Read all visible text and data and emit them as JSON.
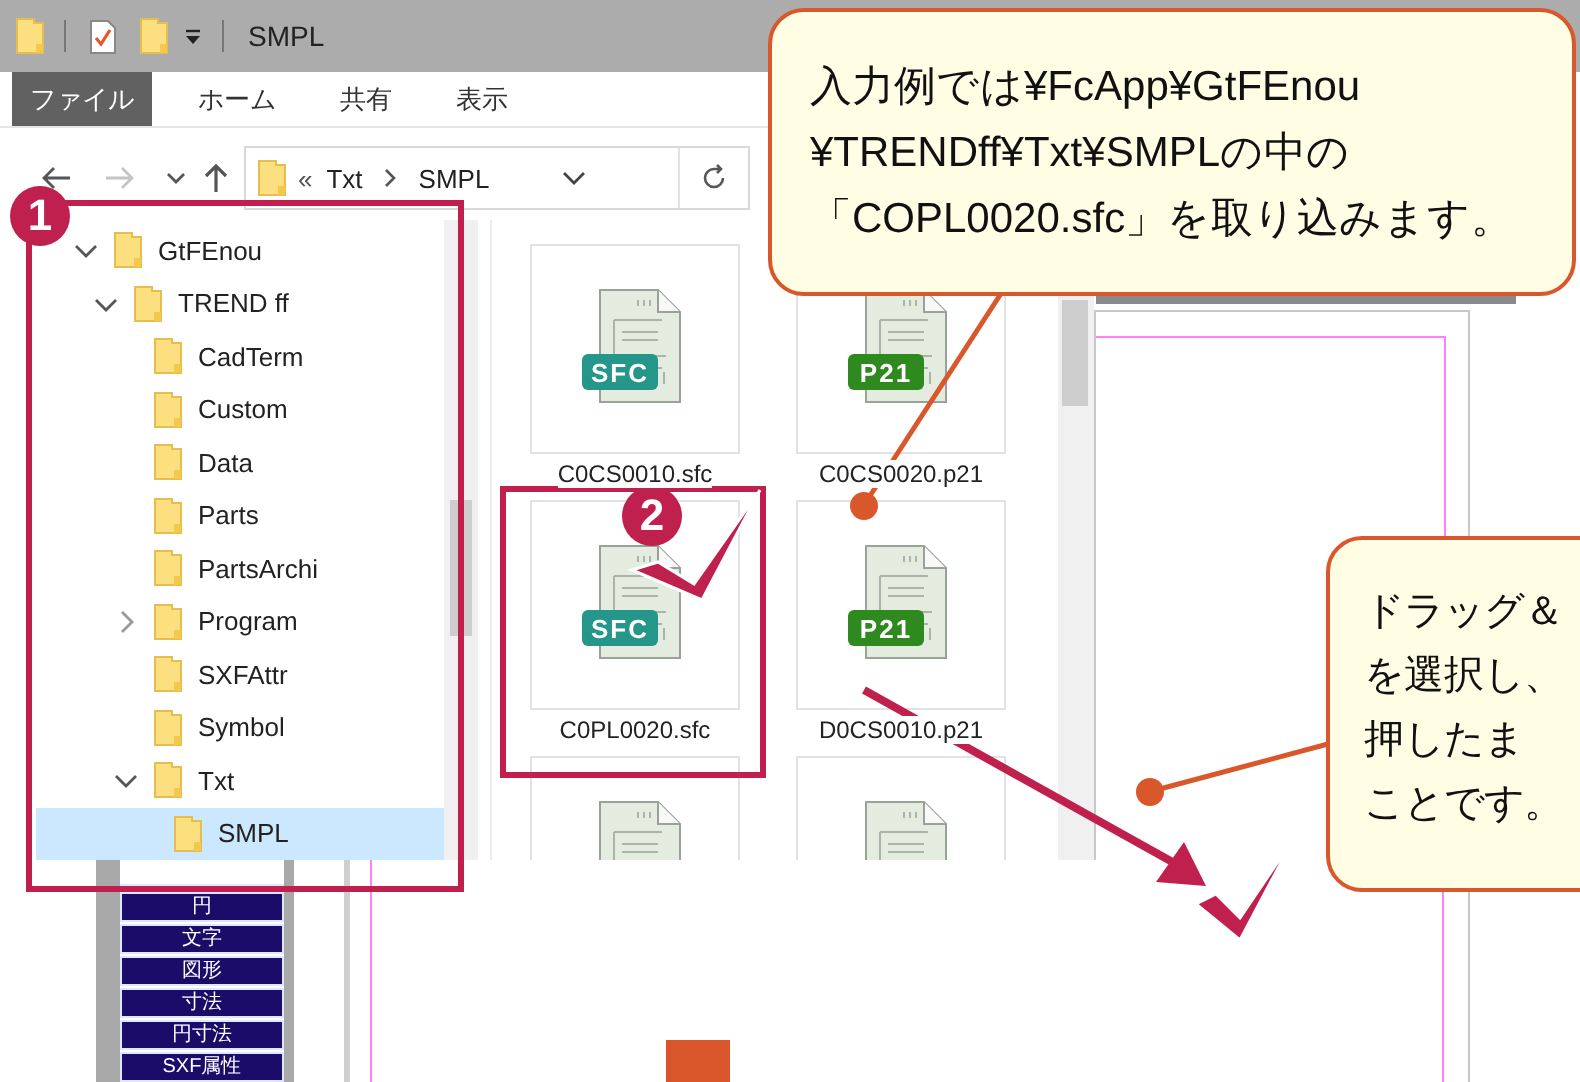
{
  "window": {
    "title": "SMPL"
  },
  "ribbon_tabs": [
    {
      "label": "ファイル",
      "selected": true
    },
    {
      "label": "ホーム",
      "selected": false
    },
    {
      "label": "共有",
      "selected": false
    },
    {
      "label": "表示",
      "selected": false
    }
  ],
  "nav_buttons": [
    {
      "kind": "back",
      "disabled": false
    },
    {
      "kind": "forward",
      "disabled": true
    },
    {
      "kind": "recent",
      "disabled": false
    },
    {
      "kind": "up",
      "disabled": false
    }
  ],
  "address": {
    "overflow": "«",
    "path": [
      "Txt",
      "SMPL"
    ]
  },
  "tree": [
    {
      "label": "GtFEnou",
      "expandable": true,
      "expanded": true,
      "selected": false,
      "children": [
        {
          "label": "TREND ff",
          "expandable": true,
          "expanded": true,
          "selected": false,
          "children": [
            {
              "label": "CadTerm",
              "expandable": false,
              "selected": false
            },
            {
              "label": "Custom",
              "expandable": false,
              "selected": false
            },
            {
              "label": "Data",
              "expandable": false,
              "selected": false
            },
            {
              "label": "Parts",
              "expandable": false,
              "selected": false
            },
            {
              "label": "PartsArchi",
              "expandable": false,
              "selected": false
            },
            {
              "label": "Program",
              "expandable": true,
              "expanded": false,
              "selected": false
            },
            {
              "label": "SXFAttr",
              "expandable": false,
              "selected": false
            },
            {
              "label": "Symbol",
              "expandable": false,
              "selected": false
            },
            {
              "label": "Txt",
              "expandable": true,
              "expanded": true,
              "selected": false,
              "children": [
                {
                  "label": "SMPL",
                  "expandable": false,
                  "selected": true
                }
              ]
            }
          ]
        }
      ]
    }
  ],
  "files": [
    {
      "name": "C0CS0010.sfc",
      "kind": "sfc",
      "badge": "SFC"
    },
    {
      "name": "C0CS0020.p21",
      "kind": "p21",
      "badge": "P21"
    },
    {
      "name": "C0PL0020.sfc",
      "kind": "sfc",
      "badge": "SFC"
    },
    {
      "name": "D0CS0010.p21",
      "kind": "p21",
      "badge": "P21"
    },
    {
      "kind": "partial"
    },
    {
      "kind": "partial"
    }
  ],
  "cad_toolbar": [
    "円",
    "文字",
    "図形",
    "寸法",
    "円寸法",
    "SXF属性"
  ],
  "callouts": [
    {
      "lines": [
        "入力例では¥FcApp¥GtFEnou",
        "¥TRENDff¥Txt¥SMPLの中の",
        "「COPL0020.sfc」を取り込みます。"
      ]
    },
    {
      "lines": [
        "ドラッグ＆",
        "を選択し、",
        "押したま",
        "ことです。"
      ]
    }
  ],
  "steps": [
    {
      "number": "1"
    },
    {
      "number": "2"
    }
  ]
}
